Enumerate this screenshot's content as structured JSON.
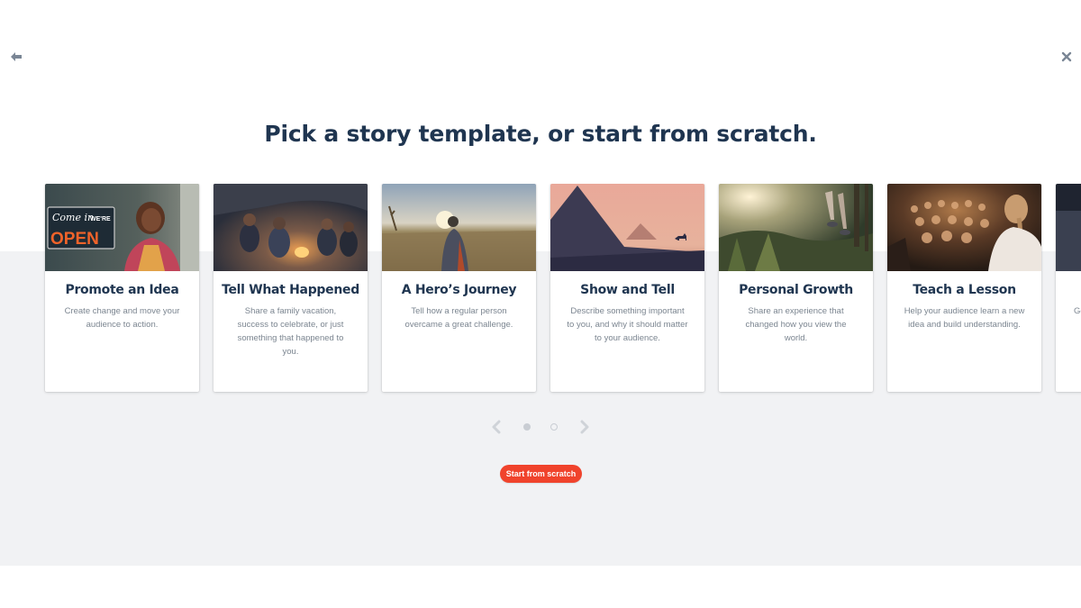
{
  "header": {
    "back_icon": "back-arrow-icon",
    "close_icon": "close-icon",
    "title": "Pick a story template, or start from scratch."
  },
  "templates": [
    {
      "title": "Promote an Idea",
      "description": "Create change and move your audience to action.",
      "image": "woman-at-shop-door-with-open-sign",
      "sign_line1": "Come in",
      "sign_line2": "WE'RE",
      "sign_line3": "OPEN"
    },
    {
      "title": "Tell What Happened",
      "description": "Share a family vacation, success to celebrate, or just something that happened to you.",
      "image": "friends-around-campfire"
    },
    {
      "title": "A Hero’s Journey",
      "description": "Tell how a regular person overcame a great challenge.",
      "image": "person-in-wheat-field-at-sunset"
    },
    {
      "title": "Show and Tell",
      "description": "Describe something important to you, and why it should matter to your audience.",
      "image": "pyramids-at-dusk"
    },
    {
      "title": "Personal Growth",
      "description": "Share an experience that changed how you view the world.",
      "image": "hikers-in-forest"
    },
    {
      "title": "Teach a Lesson",
      "description": "Help your audience learn a new idea and build understanding.",
      "image": "speaker-facing-audience"
    },
    {
      "title": "",
      "description": "Ge",
      "image": "partial-next-card"
    }
  ],
  "pager": {
    "prev_icon": "chevron-left-icon",
    "next_icon": "chevron-right-icon",
    "pages": 2,
    "current": 1
  },
  "actions": {
    "start_scratch_label": "Start from scratch"
  },
  "colors": {
    "title": "#1f3550",
    "accent": "#f0432c",
    "band": "#f1f2f4",
    "description": "#7b8590"
  }
}
